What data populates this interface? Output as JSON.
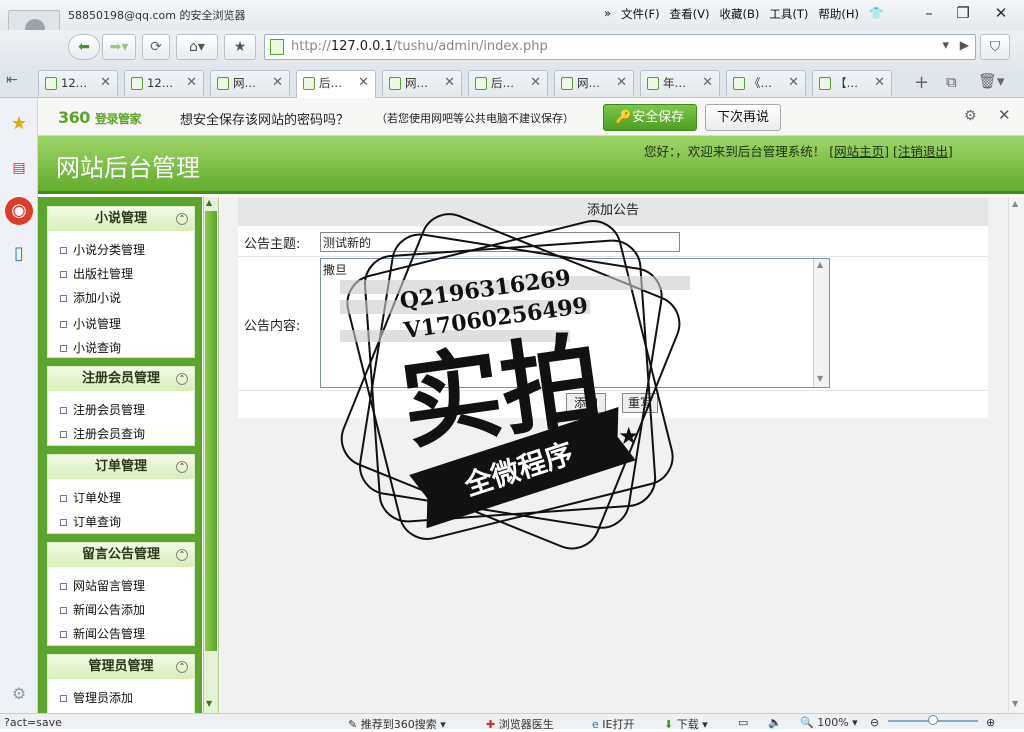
{
  "browser": {
    "account": "58850198@qq.com 的安全浏览器",
    "menu": [
      "文件(F)",
      "查看(V)",
      "收藏(B)",
      "工具(T)",
      "帮助(H)"
    ],
    "url_prefix": "http://",
    "url_host": "127.0.0.1",
    "url_path": "/tushu/admin/index.php",
    "tabs": [
      {
        "label": "12…",
        "active": false
      },
      {
        "label": "12…",
        "active": false
      },
      {
        "label": "网…",
        "active": false
      },
      {
        "label": "后…",
        "active": true
      },
      {
        "label": "网…",
        "active": false
      },
      {
        "label": "后…",
        "active": false
      },
      {
        "label": "网…",
        "active": false
      },
      {
        "label": "年…",
        "active": false
      },
      {
        "label": "《…",
        "active": false
      },
      {
        "label": "【…",
        "active": false
      }
    ]
  },
  "password_bar": {
    "logo_num": "360",
    "logo_text": "登录管家",
    "question": "想安全保存该网站的密码吗？",
    "note": "（若您使用网吧等公共电脑不建议保存）",
    "save_label": "安全保存",
    "later_label": "下次再说"
  },
  "admin": {
    "title": "网站后台管理",
    "welcome": "您好：，欢迎来到后台管理系统！",
    "link_home": "网站主页",
    "link_logout": "注销退出"
  },
  "menu_groups": [
    {
      "title": "小说管理",
      "items": [
        "小说分类管理",
        "出版社管理",
        "添加小说",
        "小说管理",
        "小说查询"
      ]
    },
    {
      "title": "注册会员管理",
      "items": [
        "注册会员管理",
        "注册会员查询"
      ]
    },
    {
      "title": "订单管理",
      "items": [
        "订单处理",
        "订单查询"
      ]
    },
    {
      "title": "留言公告管理",
      "items": [
        "网站留言管理",
        "新闻公告添加",
        "新闻公告管理"
      ]
    },
    {
      "title": "管理员管理",
      "items": [
        "管理员添加"
      ]
    }
  ],
  "form": {
    "title": "添加公告",
    "subject_label": "公告主题:",
    "subject_value": "测试新的",
    "body_label": "公告内容:",
    "body_value": "撒旦",
    "submit_label": "添加",
    "reset_label": "重写"
  },
  "watermark": {
    "contact1": "Q2196316269",
    "contact2": "V17060256499",
    "big": "实拍",
    "ribbon": "全微程序"
  },
  "status": {
    "left": "?act=save",
    "recommend": "推荐到360搜索",
    "doctor": "浏览器医生",
    "ie": "IE打开",
    "download": "下载",
    "zoom": "100%"
  }
}
